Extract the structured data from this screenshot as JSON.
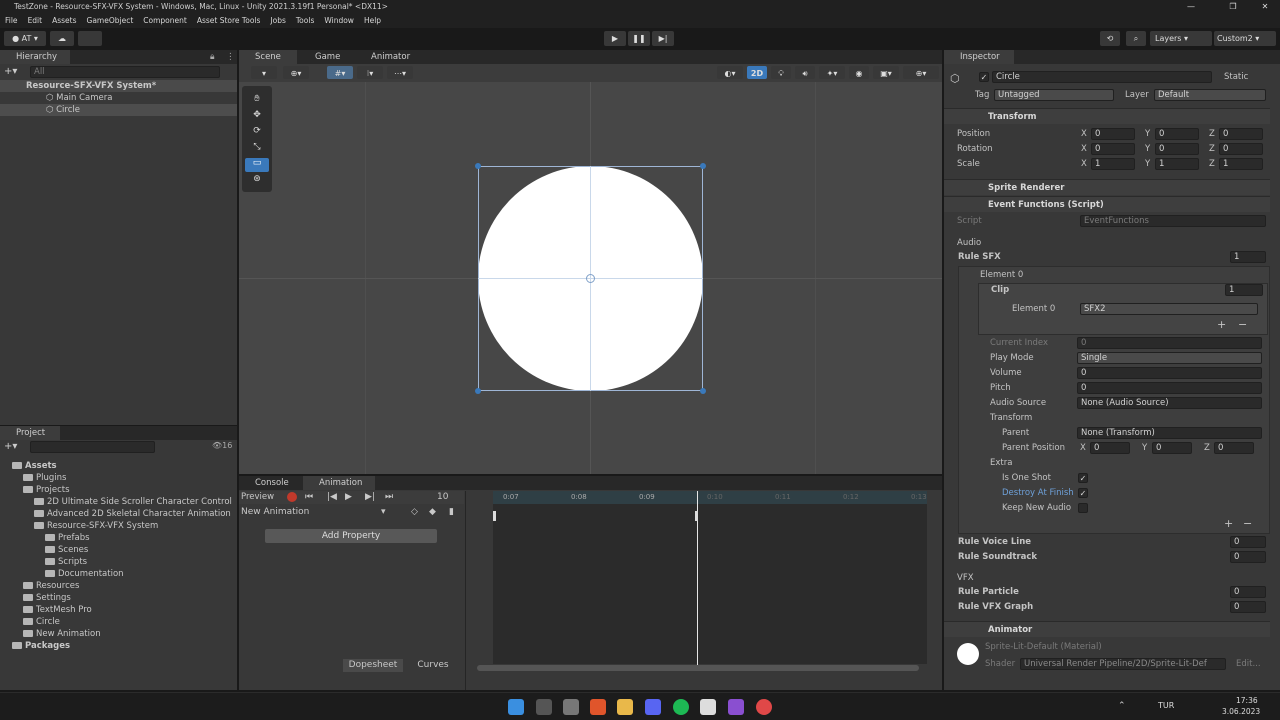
{
  "window": {
    "title": "TestZone - Resource-SFX-VFX System - Windows, Mac, Linux - Unity 2021.3.19f1 Personal* <DX11>"
  },
  "menu": [
    "File",
    "Edit",
    "Assets",
    "GameObject",
    "Component",
    "Asset Store Tools",
    "Jobs",
    "Tools",
    "Window",
    "Help"
  ],
  "toolbar": {
    "account": "AT",
    "layers": "Layers",
    "layout": "Custom2"
  },
  "hierarchy": {
    "title": "Hierarchy",
    "search_placeholder": "All",
    "scene": "Resource-SFX-VFX System*",
    "items": [
      "Main Camera",
      "Circle"
    ]
  },
  "scene_tabs": {
    "scene": "Scene",
    "game": "Game",
    "animator": "Animator",
    "mode_2d": "2D"
  },
  "project": {
    "title": "Project",
    "hidden_count": "16",
    "tree": [
      {
        "label": "Assets",
        "bold": true,
        "depth": 0
      },
      {
        "label": "Plugins",
        "depth": 1
      },
      {
        "label": "Projects",
        "depth": 1
      },
      {
        "label": "2D Ultimate Side Scroller Character Control",
        "depth": 2
      },
      {
        "label": "Advanced 2D Skeletal Character Animation",
        "depth": 2
      },
      {
        "label": "Resource-SFX-VFX System",
        "depth": 2
      },
      {
        "label": "Prefabs",
        "depth": 3
      },
      {
        "label": "Scenes",
        "depth": 3
      },
      {
        "label": "Scripts",
        "depth": 3
      },
      {
        "label": "Documentation",
        "depth": 3
      },
      {
        "label": "Resources",
        "depth": 1
      },
      {
        "label": "Settings",
        "depth": 1
      },
      {
        "label": "TextMesh Pro",
        "depth": 1
      },
      {
        "label": "Circle",
        "depth": 1
      },
      {
        "label": "New Animation",
        "depth": 1
      },
      {
        "label": "Packages",
        "bold": true,
        "depth": 0
      }
    ]
  },
  "animation": {
    "console_tab": "Console",
    "animation_tab": "Animation",
    "preview": "Preview",
    "frame": "10",
    "clip": "New Animation",
    "add_property": "Add Property",
    "dopesheet": "Dopesheet",
    "curves": "Curves",
    "ticks": [
      "0:07",
      "0:08",
      "0:09",
      "0:10",
      "0:11",
      "0:12",
      "0:13"
    ]
  },
  "inspector": {
    "title": "Inspector",
    "object_name": "Circle",
    "static": "Static",
    "tag_label": "Tag",
    "tag": "Untagged",
    "layer_label": "Layer",
    "layer": "Default",
    "transform": {
      "title": "Transform",
      "position_label": "Position",
      "rotation_label": "Rotation",
      "scale_label": "Scale",
      "position": [
        "0",
        "0",
        "0"
      ],
      "rotation": [
        "0",
        "0",
        "0"
      ],
      "scale": [
        "1",
        "1",
        "1"
      ]
    },
    "sprite_renderer": "Sprite Renderer",
    "event_functions": "Event Functions (Script)",
    "script_label": "Script",
    "script_value": "EventFunctions",
    "audio_label": "Audio",
    "rule_sfx": "Rule SFX",
    "rule_sfx_count": "1",
    "element0": "Element 0",
    "clip_label": "Clip",
    "clip_count": "1",
    "clip_element_label": "Element 0",
    "clip_element_value": "SFX2",
    "current_index_label": "Current Index",
    "current_index": "0",
    "play_mode_label": "Play Mode",
    "play_mode": "Single",
    "volume_label": "Volume",
    "volume": "0",
    "pitch_label": "Pitch",
    "pitch": "0",
    "audio_source_label": "Audio Source",
    "audio_source": "None (Audio Source)",
    "transform_sub": "Transform",
    "parent_label": "Parent",
    "parent": "None (Transform)",
    "parent_position_label": "Parent Position",
    "parent_position": [
      "0",
      "0",
      "0"
    ],
    "extra_label": "Extra",
    "is_one_shot": "Is One Shot",
    "destroy_at_finish": "Destroy At Finish",
    "keep_new_audio": "Keep New Audio",
    "rule_voice_line": "Rule Voice Line",
    "rule_voice_line_count": "0",
    "rule_soundtrack": "Rule Soundtrack",
    "rule_soundtrack_count": "0",
    "vfx_label": "VFX",
    "rule_particle": "Rule Particle",
    "rule_particle_count": "0",
    "rule_vfx_graph": "Rule VFX Graph",
    "rule_vfx_graph_count": "0",
    "animator": "Animator",
    "material": "Sprite-Lit-Default (Material)",
    "shader_label": "Shader",
    "shader": "Universal Render Pipeline/2D/Sprite-Lit-Def",
    "edit": "Edit..."
  },
  "taskbar": {
    "lang": "TUR",
    "time": "17:36",
    "date": "3.06.2023"
  },
  "colors": {
    "accent": "#3a79bb",
    "panel": "#383838",
    "scene_bg": "#474747"
  }
}
